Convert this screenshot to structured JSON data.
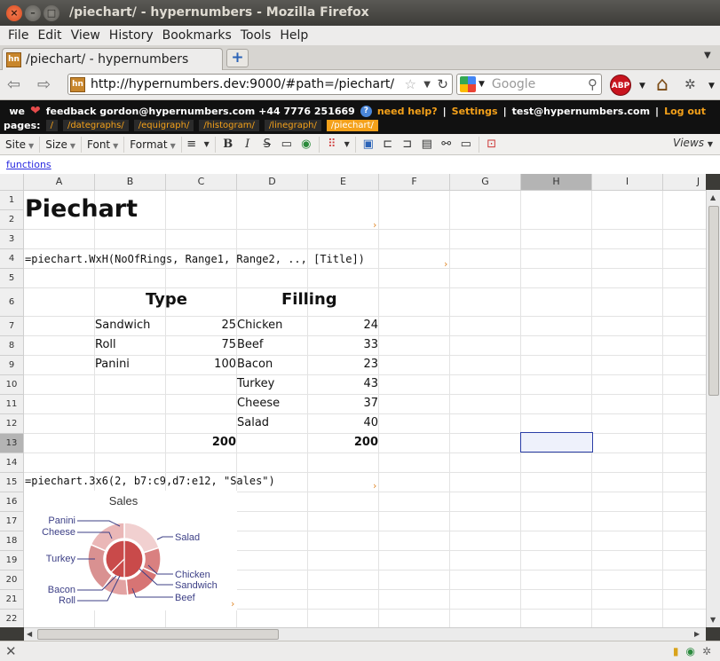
{
  "window": {
    "title": "/piechart/ - hypernumbers - Mozilla Firefox"
  },
  "menu": [
    "File",
    "Edit",
    "View",
    "History",
    "Bookmarks",
    "Tools",
    "Help"
  ],
  "tab": {
    "title": "/piechart/ - hypernumbers",
    "favicon": "hn"
  },
  "nav": {
    "url": "http://hypernumbers.dev:9000/#path=/piechart/",
    "search_placeholder": "Google",
    "abp": "ABP"
  },
  "site": {
    "we": "we",
    "feedback": "feedback gordon@hypernumbers.com +44 7776 251669",
    "need_help": "need help?",
    "sep": "|",
    "settings": "Settings",
    "user": "test@hypernumbers.com",
    "logout": "Log out",
    "pages_label": "pages:",
    "pages": [
      "/",
      "/dategraphs/",
      "/equigraph/",
      "/histogram/",
      "/linegraph/",
      "/piechart/"
    ]
  },
  "toolbar": {
    "site": "Site",
    "size": "Size",
    "font": "Font",
    "format": "Format",
    "bold": "B",
    "italic": "I",
    "strike": "S",
    "views": "Views"
  },
  "functions_link": "functions",
  "sheet": {
    "columns": [
      "A",
      "B",
      "C",
      "D",
      "E",
      "F",
      "G",
      "H",
      "I",
      "J"
    ],
    "rows": [
      "1",
      "2",
      "3",
      "4",
      "5",
      "6",
      "7",
      "8",
      "9",
      "10",
      "11",
      "12",
      "13",
      "14",
      "15",
      "16",
      "17",
      "18",
      "19",
      "20",
      "21",
      "22"
    ],
    "title": "Piechart",
    "formula1": "=piechart.WxH(NoOfRings, Range1, Range2, .., [Title])",
    "type_header": "Type",
    "filling_header": "Filling",
    "types": [
      {
        "name": "Sandwich",
        "value": "25"
      },
      {
        "name": "Roll",
        "value": "75"
      },
      {
        "name": "Panini",
        "value": "100"
      }
    ],
    "fillings": [
      {
        "name": "Chicken",
        "value": "24"
      },
      {
        "name": "Beef",
        "value": "33"
      },
      {
        "name": "Bacon",
        "value": "23"
      },
      {
        "name": "Turkey",
        "value": "43"
      },
      {
        "name": "Cheese",
        "value": "37"
      },
      {
        "name": "Salad",
        "value": "40"
      }
    ],
    "total_types": "200",
    "total_fillings": "200",
    "formula2": "=piechart.3x6(2, b7:c9,d7:e12, \"Sales\")"
  },
  "chart_data": {
    "type": "pie",
    "title": "Sales",
    "rings": [
      {
        "name": "inner",
        "labels": [
          "Sandwich",
          "Roll",
          "Panini"
        ],
        "values": [
          25,
          75,
          100
        ]
      },
      {
        "name": "outer",
        "labels": [
          "Chicken",
          "Beef",
          "Bacon",
          "Turkey",
          "Cheese",
          "Salad"
        ],
        "values": [
          24,
          33,
          23,
          43,
          37,
          40
        ]
      }
    ],
    "labels_shown": [
      "Panini",
      "Cheese",
      "Salad",
      "Turkey",
      "Chicken",
      "Sandwich",
      "Bacon",
      "Roll",
      "Beef"
    ],
    "colors": {
      "inner": "#c94a4a",
      "outer": "#e3a3a3"
    }
  }
}
